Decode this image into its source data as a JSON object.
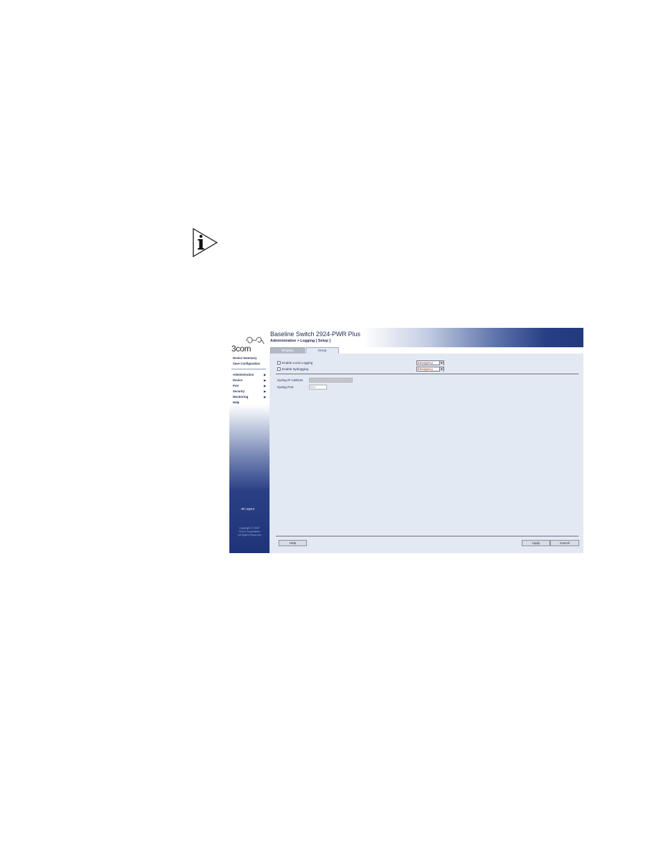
{
  "note": {
    "icon": "info-icon"
  },
  "app": {
    "brand": "3com",
    "title": "Baseline Switch 2924-PWR Plus",
    "breadcrumb": "Administration > Logging [ Setup ]"
  },
  "sidebar": {
    "links": [
      "Device Summary",
      "Save Configuration"
    ],
    "items": [
      {
        "label": "Administration",
        "has_submenu": true
      },
      {
        "label": "Device",
        "has_submenu": true
      },
      {
        "label": "Port",
        "has_submenu": true
      },
      {
        "label": "Security",
        "has_submenu": true
      },
      {
        "label": "Monitoring",
        "has_submenu": true
      },
      {
        "label": "Help",
        "has_submenu": false
      }
    ],
    "logout": "Logout",
    "copyright": [
      "Copyright © 2007",
      "3Com Corporation",
      "All Rights Reserved"
    ]
  },
  "tabs": [
    {
      "label": "Display",
      "active": false
    },
    {
      "label": "Setup",
      "active": true
    }
  ],
  "form": {
    "local_logging": {
      "label": "Enable Local Logging",
      "checked": false,
      "severity": "Emergency"
    },
    "syslogging": {
      "label": "Enable Syslogging",
      "checked": false,
      "severity": "Emergency"
    },
    "syslog_ip": {
      "label": "Syslog IP Address",
      "value": ""
    },
    "syslog_port": {
      "label": "Syslog Port",
      "value": "514"
    }
  },
  "buttons": {
    "help": "Help",
    "apply": "Apply",
    "cancel": "Cancel"
  },
  "colors": {
    "header_dark": "#23397f",
    "content_bg": "#e3e9f3",
    "sidebar_dark": "#1f3478"
  }
}
